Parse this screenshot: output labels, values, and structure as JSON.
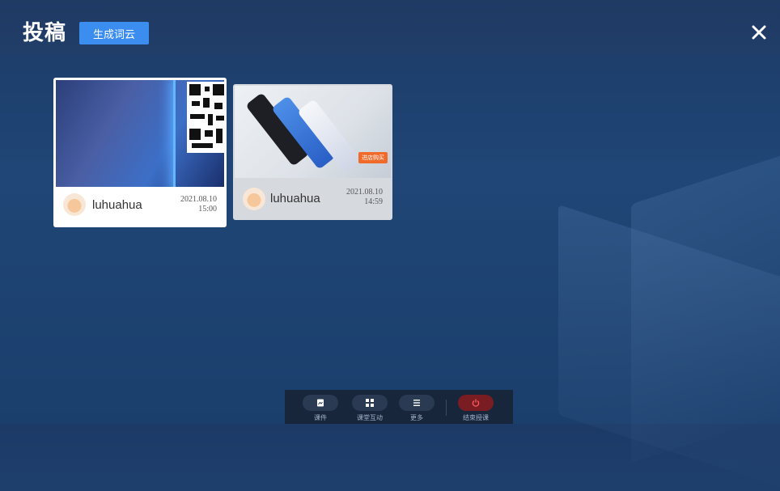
{
  "header": {
    "title": "投稿",
    "wordcloud_button": "生成词云"
  },
  "cards": [
    {
      "username": "luhuahua",
      "date": "2021.08.10",
      "time": "15:00"
    },
    {
      "username": "luhuahua",
      "date": "2021.08.10",
      "time": "14:59",
      "badge": "进店购买"
    }
  ],
  "toolbar": {
    "items": [
      {
        "label": "课件",
        "icon": "courseware-icon"
      },
      {
        "label": "课堂互动",
        "icon": "grid-icon"
      },
      {
        "label": "更多",
        "icon": "menu-icon"
      },
      {
        "label": "结束授课",
        "icon": "power-icon"
      }
    ]
  },
  "colors": {
    "accent": "#3b8df0",
    "danger": "#d8343c",
    "background": "#1f4676"
  }
}
